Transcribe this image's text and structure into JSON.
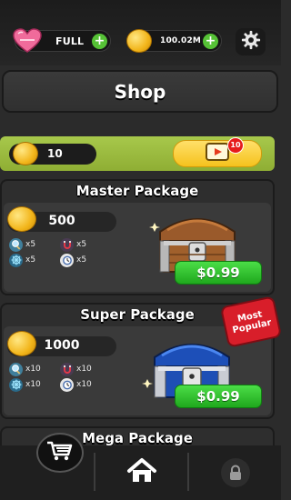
{
  "topbar": {
    "lives_label": "FULL",
    "coins_label": "100.02M",
    "plus_symbol": "+",
    "icons": [
      "heart-icon",
      "coin-icon",
      "gear-icon"
    ]
  },
  "shop": {
    "title": "Shop"
  },
  "reward_bar": {
    "coin_count": "10",
    "video_badge": "10",
    "icons": [
      "coin-icon",
      "video-icon"
    ]
  },
  "packages": [
    {
      "title": "Master Package",
      "coins": "500",
      "items": [
        {
          "icon": "magnifier-icon",
          "qty": "x5"
        },
        {
          "icon": "magnet-icon",
          "qty": "x5"
        },
        {
          "icon": "compass-wheel-icon",
          "qty": "x5"
        },
        {
          "icon": "stopwatch-icon",
          "qty": "x5"
        }
      ],
      "price": "$0.99",
      "chest": "wooden-chest"
    },
    {
      "title": "Super Package",
      "coins": "1000",
      "items": [
        {
          "icon": "magnifier-icon",
          "qty": "x10"
        },
        {
          "icon": "magnet-icon",
          "qty": "x10"
        },
        {
          "icon": "compass-wheel-icon",
          "qty": "x10"
        },
        {
          "icon": "stopwatch-icon",
          "qty": "x10"
        }
      ],
      "price": "$0.99",
      "chest": "blue-chest",
      "ribbon_line1": "Most",
      "ribbon_line2": "Popular"
    },
    {
      "title": "Mega Package"
    }
  ],
  "bottom_nav": {
    "items": [
      "cart-icon",
      "home-icon",
      "lock-icon"
    ]
  },
  "colors": {
    "price_green": "#2cc12a",
    "accent_green_bar": "#9dbd41",
    "ribbon_red": "#d81e2a",
    "coin_gold": "#f2b51a"
  }
}
